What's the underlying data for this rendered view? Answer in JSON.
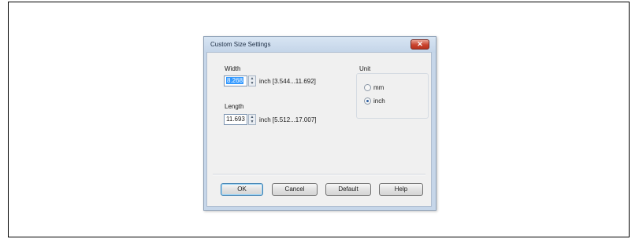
{
  "dialog": {
    "title": "Custom Size Settings",
    "close_icon": "close-icon"
  },
  "width": {
    "label": "Width",
    "value": "8.268",
    "range": "inch [3.544...11.692]"
  },
  "length": {
    "label": "Length",
    "value": "11.693",
    "range": "inch [5.512...17.007]"
  },
  "unit": {
    "label": "Unit",
    "options": [
      {
        "label": "mm",
        "checked": false
      },
      {
        "label": "inch",
        "checked": true
      }
    ]
  },
  "buttons": {
    "ok": "OK",
    "cancel": "Cancel",
    "default": "Default",
    "help": "Help"
  },
  "colors": {
    "title_bar": "#c6d6e9",
    "close_button": "#c9442e",
    "selection": "#3399ff",
    "default_button_border": "#3c7fb1"
  }
}
